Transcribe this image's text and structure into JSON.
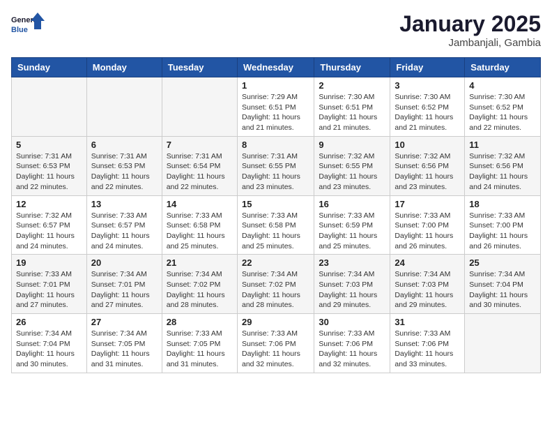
{
  "logo": {
    "text_general": "General",
    "text_blue": "Blue"
  },
  "title": "January 2025",
  "subtitle": "Jambanjali, Gambia",
  "days_of_week": [
    "Sunday",
    "Monday",
    "Tuesday",
    "Wednesday",
    "Thursday",
    "Friday",
    "Saturday"
  ],
  "weeks": [
    [
      {
        "day": "",
        "sunrise": "",
        "sunset": "",
        "daylight": ""
      },
      {
        "day": "",
        "sunrise": "",
        "sunset": "",
        "daylight": ""
      },
      {
        "day": "",
        "sunrise": "",
        "sunset": "",
        "daylight": ""
      },
      {
        "day": "1",
        "sunrise": "Sunrise: 7:29 AM",
        "sunset": "Sunset: 6:51 PM",
        "daylight": "Daylight: 11 hours and 21 minutes."
      },
      {
        "day": "2",
        "sunrise": "Sunrise: 7:30 AM",
        "sunset": "Sunset: 6:51 PM",
        "daylight": "Daylight: 11 hours and 21 minutes."
      },
      {
        "day": "3",
        "sunrise": "Sunrise: 7:30 AM",
        "sunset": "Sunset: 6:52 PM",
        "daylight": "Daylight: 11 hours and 21 minutes."
      },
      {
        "day": "4",
        "sunrise": "Sunrise: 7:30 AM",
        "sunset": "Sunset: 6:52 PM",
        "daylight": "Daylight: 11 hours and 22 minutes."
      }
    ],
    [
      {
        "day": "5",
        "sunrise": "Sunrise: 7:31 AM",
        "sunset": "Sunset: 6:53 PM",
        "daylight": "Daylight: 11 hours and 22 minutes."
      },
      {
        "day": "6",
        "sunrise": "Sunrise: 7:31 AM",
        "sunset": "Sunset: 6:53 PM",
        "daylight": "Daylight: 11 hours and 22 minutes."
      },
      {
        "day": "7",
        "sunrise": "Sunrise: 7:31 AM",
        "sunset": "Sunset: 6:54 PM",
        "daylight": "Daylight: 11 hours and 22 minutes."
      },
      {
        "day": "8",
        "sunrise": "Sunrise: 7:31 AM",
        "sunset": "Sunset: 6:55 PM",
        "daylight": "Daylight: 11 hours and 23 minutes."
      },
      {
        "day": "9",
        "sunrise": "Sunrise: 7:32 AM",
        "sunset": "Sunset: 6:55 PM",
        "daylight": "Daylight: 11 hours and 23 minutes."
      },
      {
        "day": "10",
        "sunrise": "Sunrise: 7:32 AM",
        "sunset": "Sunset: 6:56 PM",
        "daylight": "Daylight: 11 hours and 23 minutes."
      },
      {
        "day": "11",
        "sunrise": "Sunrise: 7:32 AM",
        "sunset": "Sunset: 6:56 PM",
        "daylight": "Daylight: 11 hours and 24 minutes."
      }
    ],
    [
      {
        "day": "12",
        "sunrise": "Sunrise: 7:32 AM",
        "sunset": "Sunset: 6:57 PM",
        "daylight": "Daylight: 11 hours and 24 minutes."
      },
      {
        "day": "13",
        "sunrise": "Sunrise: 7:33 AM",
        "sunset": "Sunset: 6:57 PM",
        "daylight": "Daylight: 11 hours and 24 minutes."
      },
      {
        "day": "14",
        "sunrise": "Sunrise: 7:33 AM",
        "sunset": "Sunset: 6:58 PM",
        "daylight": "Daylight: 11 hours and 25 minutes."
      },
      {
        "day": "15",
        "sunrise": "Sunrise: 7:33 AM",
        "sunset": "Sunset: 6:58 PM",
        "daylight": "Daylight: 11 hours and 25 minutes."
      },
      {
        "day": "16",
        "sunrise": "Sunrise: 7:33 AM",
        "sunset": "Sunset: 6:59 PM",
        "daylight": "Daylight: 11 hours and 25 minutes."
      },
      {
        "day": "17",
        "sunrise": "Sunrise: 7:33 AM",
        "sunset": "Sunset: 7:00 PM",
        "daylight": "Daylight: 11 hours and 26 minutes."
      },
      {
        "day": "18",
        "sunrise": "Sunrise: 7:33 AM",
        "sunset": "Sunset: 7:00 PM",
        "daylight": "Daylight: 11 hours and 26 minutes."
      }
    ],
    [
      {
        "day": "19",
        "sunrise": "Sunrise: 7:33 AM",
        "sunset": "Sunset: 7:01 PM",
        "daylight": "Daylight: 11 hours and 27 minutes."
      },
      {
        "day": "20",
        "sunrise": "Sunrise: 7:34 AM",
        "sunset": "Sunset: 7:01 PM",
        "daylight": "Daylight: 11 hours and 27 minutes."
      },
      {
        "day": "21",
        "sunrise": "Sunrise: 7:34 AM",
        "sunset": "Sunset: 7:02 PM",
        "daylight": "Daylight: 11 hours and 28 minutes."
      },
      {
        "day": "22",
        "sunrise": "Sunrise: 7:34 AM",
        "sunset": "Sunset: 7:02 PM",
        "daylight": "Daylight: 11 hours and 28 minutes."
      },
      {
        "day": "23",
        "sunrise": "Sunrise: 7:34 AM",
        "sunset": "Sunset: 7:03 PM",
        "daylight": "Daylight: 11 hours and 29 minutes."
      },
      {
        "day": "24",
        "sunrise": "Sunrise: 7:34 AM",
        "sunset": "Sunset: 7:03 PM",
        "daylight": "Daylight: 11 hours and 29 minutes."
      },
      {
        "day": "25",
        "sunrise": "Sunrise: 7:34 AM",
        "sunset": "Sunset: 7:04 PM",
        "daylight": "Daylight: 11 hours and 30 minutes."
      }
    ],
    [
      {
        "day": "26",
        "sunrise": "Sunrise: 7:34 AM",
        "sunset": "Sunset: 7:04 PM",
        "daylight": "Daylight: 11 hours and 30 minutes."
      },
      {
        "day": "27",
        "sunrise": "Sunrise: 7:34 AM",
        "sunset": "Sunset: 7:05 PM",
        "daylight": "Daylight: 11 hours and 31 minutes."
      },
      {
        "day": "28",
        "sunrise": "Sunrise: 7:33 AM",
        "sunset": "Sunset: 7:05 PM",
        "daylight": "Daylight: 11 hours and 31 minutes."
      },
      {
        "day": "29",
        "sunrise": "Sunrise: 7:33 AM",
        "sunset": "Sunset: 7:06 PM",
        "daylight": "Daylight: 11 hours and 32 minutes."
      },
      {
        "day": "30",
        "sunrise": "Sunrise: 7:33 AM",
        "sunset": "Sunset: 7:06 PM",
        "daylight": "Daylight: 11 hours and 32 minutes."
      },
      {
        "day": "31",
        "sunrise": "Sunrise: 7:33 AM",
        "sunset": "Sunset: 7:06 PM",
        "daylight": "Daylight: 11 hours and 33 minutes."
      },
      {
        "day": "",
        "sunrise": "",
        "sunset": "",
        "daylight": ""
      }
    ]
  ]
}
